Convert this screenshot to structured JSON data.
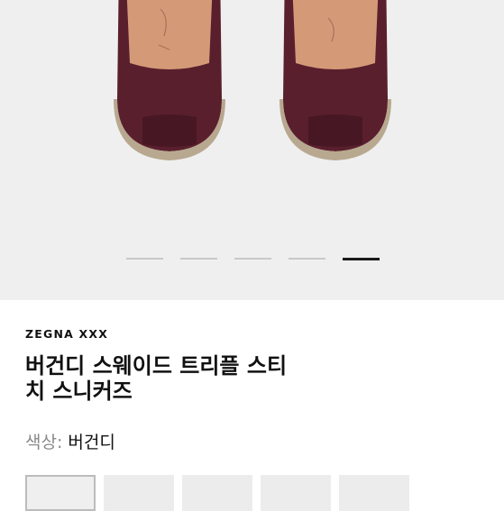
{
  "product": {
    "brand": "ZEGNA XXX",
    "title_line1": "버건디 스웨이드 트리플 스티",
    "title_line2": "치 스니커즈",
    "color_label": "색상:",
    "color_value": "버건디"
  },
  "gallery": {
    "image_count": 5,
    "active_index": 4,
    "image_alt": "shoe-photo"
  },
  "colors": {
    "background": "#efefef",
    "suede": "#5a1f2d",
    "insole": "#d49a78",
    "sole": "#b8a88f",
    "active_dot": "#1a1a1a"
  },
  "swatches_count": 5
}
